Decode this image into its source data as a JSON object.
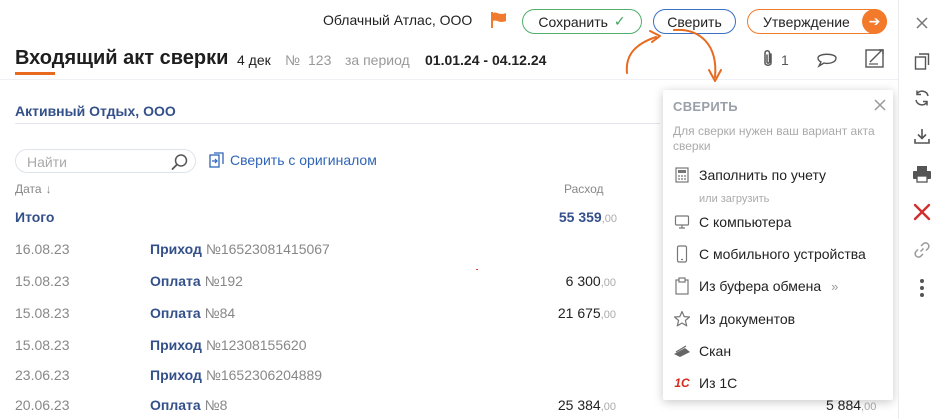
{
  "header": {
    "org_name": "Облачный Атлас, ООО",
    "save_label": "Сохранить",
    "verify_label": "Сверить",
    "approve_label": "Утверждение"
  },
  "document": {
    "title": "Входящий акт сверки",
    "date": "4 дек",
    "number_sign": "№",
    "number": "123",
    "period_label": "за период",
    "period_value": "01.01.24 - 04.12.24",
    "attachments_count": "1"
  },
  "counterparty": "Активный Отдых, ООО",
  "search": {
    "placeholder": "Найти",
    "compare_label": "Сверить с оригиналом"
  },
  "table": {
    "columns": {
      "date": "Дата",
      "date_sort": "↓",
      "expense": "Расход"
    },
    "total": {
      "label": "Итого",
      "value": "55 359",
      "cents": ",00"
    },
    "rows": [
      {
        "date": "16.08.23",
        "type": "Приход",
        "number": "№16523081415067",
        "amount": "",
        "cents": ""
      },
      {
        "date": "15.08.23",
        "type": "Оплата",
        "number": "№192",
        "amount": "6 300",
        "cents": ",00"
      },
      {
        "date": "15.08.23",
        "type": "Оплата",
        "number": "№84",
        "amount": "21 675",
        "cents": ",00"
      },
      {
        "date": "15.08.23",
        "type": "Приход",
        "number": "№12308155620",
        "amount": "",
        "cents": ""
      },
      {
        "date": "23.06.23",
        "type": "Приход",
        "number": "№1652306204889",
        "amount": "",
        "cents": ""
      },
      {
        "date": "20.06.23",
        "type": "Оплата",
        "number": "№8",
        "amount": "25 384",
        "cents": ",00"
      }
    ],
    "last_row_right_amount": "5 884",
    "last_row_right_cents": ",00"
  },
  "popup": {
    "title": "СВЕРИТЬ",
    "hint": "Для сверки нужен ваш вариант акта сверки",
    "fill_from_accounting": "Заполнить по учету",
    "or_upload": "или загрузить",
    "from_computer": "С компьютера",
    "from_mobile": "С мобильного устройства",
    "from_clipboard": "Из буфера обмена",
    "from_documents": "Из документов",
    "scan": "Скан",
    "from_1c": "Из 1С",
    "icon_1c": "1С"
  },
  "colors": {
    "accent_orange": "#f37a2b",
    "save_green": "#4fae6a",
    "verify_blue": "#3b6fc4",
    "link_blue": "#2f65b7",
    "title_navy": "#34508a",
    "delete_red": "#d32f2f"
  },
  "icons": {
    "flag": "flag-icon",
    "check": "check-icon",
    "arrow_right": "arrow-right-icon",
    "paperclip": "paperclip-icon",
    "chat": "chat-icon",
    "sign": "sign-document-icon",
    "search": "search-icon",
    "compare": "compare-document-icon",
    "close": "close-icon",
    "copy": "copy-icon",
    "refresh": "refresh-icon",
    "download": "download-icon",
    "print": "printer-icon",
    "delete": "delete-icon",
    "link": "link-icon",
    "more": "more-vertical-icon"
  }
}
